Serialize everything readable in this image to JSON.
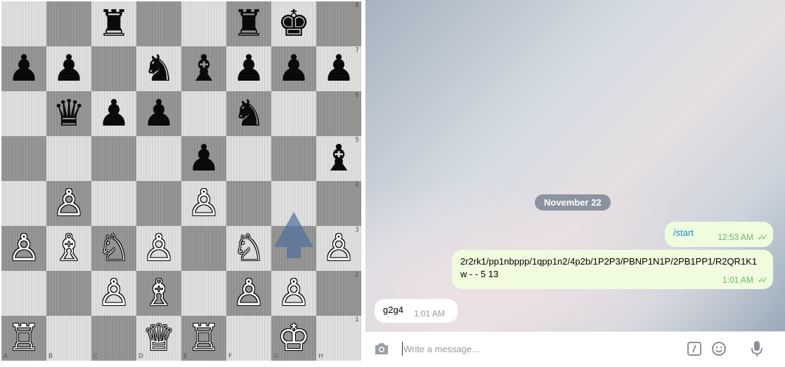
{
  "board": {
    "files": [
      "A",
      "B",
      "C",
      "D",
      "E",
      "F",
      "G",
      "H"
    ],
    "ranks": [
      "8",
      "7",
      "6",
      "5",
      "4",
      "3",
      "2",
      "1"
    ],
    "squares": [
      [
        "",
        "",
        "♜",
        "",
        "",
        "♜",
        "♚",
        ""
      ],
      [
        "♟",
        "♟",
        "",
        "♞",
        "♝",
        "♟",
        "♟",
        "♟"
      ],
      [
        "",
        "♛",
        "♟",
        "♟",
        "",
        "♞",
        "",
        ""
      ],
      [
        "",
        "",
        "",
        "",
        "♟",
        "",
        "",
        "♝"
      ],
      [
        "",
        "♙",
        "",
        "",
        "♙",
        "",
        "",
        ""
      ],
      [
        "♙",
        "♗",
        "♘",
        "♙",
        "",
        "♘",
        "",
        "♙"
      ],
      [
        "",
        "",
        "♙",
        "♗",
        "",
        "♙",
        "♙",
        ""
      ],
      [
        "♖",
        "",
        "",
        "♕",
        "♖",
        "",
        "♔",
        ""
      ]
    ],
    "arrow": {
      "from": "g2",
      "to": "g4",
      "color": "#4f6f9e"
    }
  },
  "chat": {
    "date": "November 22",
    "messages": [
      {
        "direction": "out",
        "text": "/start",
        "time": "12:53 AM",
        "status": "read"
      },
      {
        "direction": "out",
        "text": "2r2rk1/pp1nbppp/1qpp1n2/4p2b/1P2P3/PBNP1N1P/2PB1PP1/R2QR1K1 w - - 5 13",
        "time": "1:01 AM",
        "status": "read"
      },
      {
        "direction": "in",
        "text": "g2g4",
        "time": "1:01 AM"
      }
    ],
    "input": {
      "placeholder": "Write a message..."
    },
    "icons": {
      "camera": "camera-icon",
      "commands": "slash-command-icon",
      "emoji": "emoji-icon",
      "mic": "microphone-icon"
    },
    "colors": {
      "outgoing_bubble": "#effdde",
      "incoming_bubble": "#ffffff",
      "date_pill": "#76808f",
      "check": "#6ab56a"
    }
  }
}
